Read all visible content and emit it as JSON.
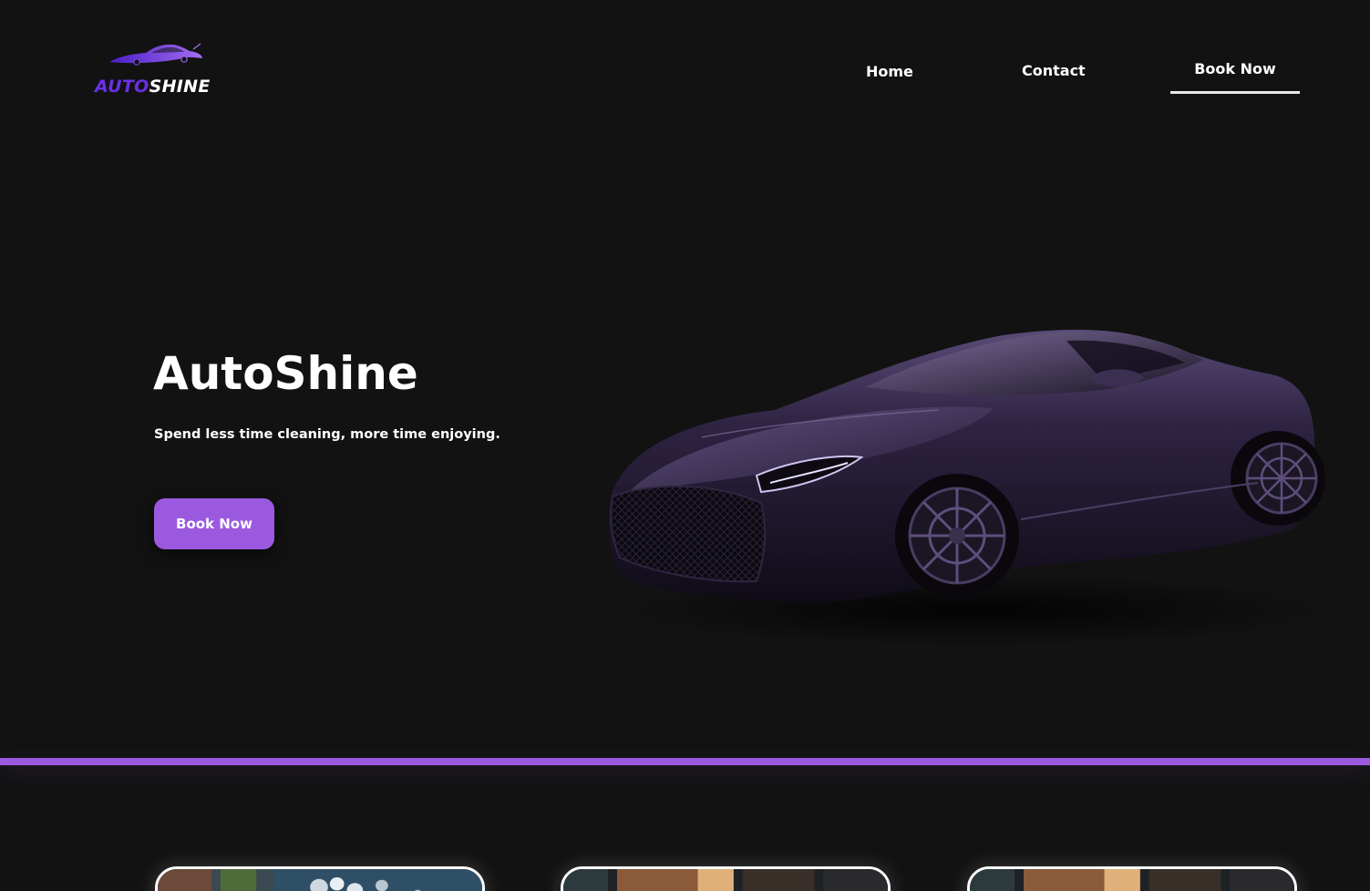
{
  "brand": {
    "logo_part1": "AUTO",
    "logo_part2": "SHINE",
    "logo_icon": "sports-car-silhouette-icon",
    "accent_color": "#9b59e0",
    "logo_accent_color": "#6a2fe8"
  },
  "nav": {
    "items": [
      {
        "label": "Home"
      },
      {
        "label": "Contact"
      },
      {
        "label": "Book Now"
      }
    ],
    "active": "Book Now"
  },
  "hero": {
    "title": "AutoShine",
    "subtitle": "Spend less time cleaning, more time enjoying.",
    "cta_label": "Book Now",
    "image": "sports-car-image"
  },
  "services": {
    "cards": [
      {
        "image": "car-wash-foam-image"
      },
      {
        "image": "interior-detailing-image"
      },
      {
        "image": "interior-detailing-image"
      }
    ]
  },
  "colors": {
    "background": "#121212",
    "text": "#ffffff",
    "accent": "#9b59e0"
  }
}
